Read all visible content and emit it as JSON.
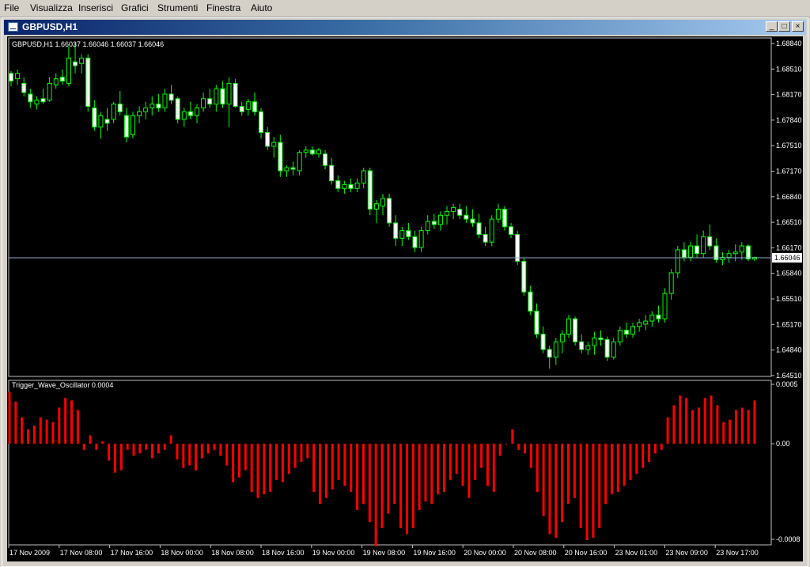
{
  "menu": [
    "File",
    "Visualizza",
    "Inserisci",
    "Grafici",
    "Strumenti",
    "Finestra",
    "Aiuto"
  ],
  "window": {
    "title": "GBPUSD,H1",
    "buttons": {
      "minimize": "_",
      "restore": "□",
      "close": "×"
    }
  },
  "main": {
    "info": "GBPUSD,H1  1.66037 1.66046 1.66037 1.66046",
    "price_labels": [
      "1.68840",
      "1.68510",
      "1.68170",
      "1.67840",
      "1.67510",
      "1.67170",
      "1.66840",
      "1.66510",
      "1.66170",
      "1.65840",
      "1.65510",
      "1.65170",
      "1.64840",
      "1.64510"
    ],
    "current_price": "1.66046"
  },
  "indicator": {
    "label": "Trigger_Wave_Oscillator 0.0004",
    "scale_labels": [
      "0.0005",
      "0.00",
      "-0.0008"
    ]
  },
  "time_labels": [
    "17 Nov 2009",
    "17 Nov 08:00",
    "17 Nov 16:00",
    "18 Nov 00:00",
    "18 Nov 08:00",
    "18 Nov 16:00",
    "19 Nov 00:00",
    "19 Nov 08:00",
    "19 Nov 16:00",
    "20 Nov 00:00",
    "20 Nov 08:00",
    "20 Nov 16:00",
    "23 Nov 01:00",
    "23 Nov 09:00",
    "23 Nov 17:00"
  ],
  "colors": {
    "candle": "#00ff00",
    "bull_body": "#000000",
    "bear_body": "#ffffff",
    "osc_bar": "#ff0000",
    "price_line": "#8fa8c8"
  },
  "chart_data": [
    {
      "type": "candlestick",
      "title": "GBPUSD,H1",
      "ylim": [
        1.645,
        1.69
      ],
      "ohlc": [
        [
          1.6845,
          1.6848,
          1.6828,
          1.6835
        ],
        [
          1.6838,
          1.685,
          1.683,
          1.6845
        ],
        [
          1.6832,
          1.684,
          1.6815,
          1.682
        ],
        [
          1.6818,
          1.6825,
          1.68,
          1.6808
        ],
        [
          1.6805,
          1.6815,
          1.6798,
          1.681
        ],
        [
          1.6812,
          1.6825,
          1.6805,
          1.6808
        ],
        [
          1.681,
          1.684,
          1.6808,
          1.6832
        ],
        [
          1.683,
          1.6845,
          1.6825,
          1.6838
        ],
        [
          1.684,
          1.685,
          1.683,
          1.6835
        ],
        [
          1.6832,
          1.688,
          1.6828,
          1.6865
        ],
        [
          1.686,
          1.6885,
          1.6845,
          1.6855
        ],
        [
          1.6858,
          1.687,
          1.6845,
          1.6865
        ],
        [
          1.6865,
          1.687,
          1.6795,
          1.6802
        ],
        [
          1.68,
          1.681,
          1.677,
          1.6775
        ],
        [
          1.6775,
          1.6795,
          1.676,
          1.679
        ],
        [
          1.6785,
          1.68,
          1.677,
          1.678
        ],
        [
          1.6785,
          1.6808,
          1.678,
          1.6805
        ],
        [
          1.6805,
          1.6822,
          1.679,
          1.6795
        ],
        [
          1.679,
          1.68,
          1.6755,
          1.6762
        ],
        [
          1.6765,
          1.6795,
          1.676,
          1.679
        ],
        [
          1.679,
          1.6802,
          1.678,
          1.6795
        ],
        [
          1.6795,
          1.6808,
          1.6785,
          1.68
        ],
        [
          1.68,
          1.6815,
          1.679,
          1.6805
        ],
        [
          1.6805,
          1.6818,
          1.6795,
          1.68
        ],
        [
          1.68,
          1.6825,
          1.6795,
          1.6818
        ],
        [
          1.6818,
          1.683,
          1.6805,
          1.681
        ],
        [
          1.6812,
          1.6815,
          1.678,
          1.6785
        ],
        [
          1.6785,
          1.68,
          1.6775,
          1.6795
        ],
        [
          1.6795,
          1.6808,
          1.6785,
          1.679
        ],
        [
          1.679,
          1.6805,
          1.678,
          1.68
        ],
        [
          1.68,
          1.682,
          1.6795,
          1.6812
        ],
        [
          1.6812,
          1.6825,
          1.68,
          1.6805
        ],
        [
          1.6805,
          1.683,
          1.6795,
          1.6825
        ],
        [
          1.6825,
          1.6835,
          1.68,
          1.6805
        ],
        [
          1.6805,
          1.684,
          1.6775,
          1.6832
        ],
        [
          1.6832,
          1.6838,
          1.68,
          1.6802
        ],
        [
          1.6802,
          1.6808,
          1.679,
          1.6795
        ],
        [
          1.6798,
          1.6812,
          1.679,
          1.6808
        ],
        [
          1.6808,
          1.682,
          1.679,
          1.6795
        ],
        [
          1.6795,
          1.68,
          1.676,
          1.6768
        ],
        [
          1.6768,
          1.6775,
          1.6745,
          1.675
        ],
        [
          1.675,
          1.6762,
          1.6735,
          1.6755
        ],
        [
          1.6755,
          1.6765,
          1.671,
          1.6718
        ],
        [
          1.6718,
          1.6725,
          1.671,
          1.6722
        ],
        [
          1.6722,
          1.673,
          1.6712,
          1.672
        ],
        [
          1.6718,
          1.6745,
          1.6712,
          1.6742
        ],
        [
          1.6742,
          1.675,
          1.6735,
          1.6745
        ],
        [
          1.6745,
          1.675,
          1.6738,
          1.674
        ],
        [
          1.674,
          1.6748,
          1.6735,
          1.6745
        ],
        [
          1.674,
          1.6745,
          1.672,
          1.6725
        ],
        [
          1.6725,
          1.6735,
          1.67,
          1.6705
        ],
        [
          1.6705,
          1.6712,
          1.669,
          1.6695
        ],
        [
          1.6695,
          1.6705,
          1.6688,
          1.67
        ],
        [
          1.67,
          1.6708,
          1.669,
          1.6695
        ],
        [
          1.6695,
          1.6708,
          1.669,
          1.6702
        ],
        [
          1.6702,
          1.6722,
          1.6695,
          1.6718
        ],
        [
          1.6718,
          1.6722,
          1.666,
          1.6668
        ],
        [
          1.6668,
          1.668,
          1.665,
          1.6675
        ],
        [
          1.6672,
          1.6688,
          1.666,
          1.6682
        ],
        [
          1.6682,
          1.6688,
          1.6645,
          1.665
        ],
        [
          1.665,
          1.666,
          1.662,
          1.663
        ],
        [
          1.663,
          1.6645,
          1.662,
          1.664
        ],
        [
          1.664,
          1.665,
          1.6628,
          1.6632
        ],
        [
          1.6632,
          1.664,
          1.6612,
          1.6618
        ],
        [
          1.6618,
          1.6645,
          1.6612,
          1.664
        ],
        [
          1.664,
          1.666,
          1.6635,
          1.6652
        ],
        [
          1.6652,
          1.6662,
          1.6642,
          1.6648
        ],
        [
          1.6648,
          1.6665,
          1.664,
          1.666
        ],
        [
          1.666,
          1.6672,
          1.6648,
          1.6665
        ],
        [
          1.6665,
          1.6675,
          1.6655,
          1.667
        ],
        [
          1.6668,
          1.6675,
          1.6655,
          1.666
        ],
        [
          1.666,
          1.6672,
          1.665,
          1.6655
        ],
        [
          1.6655,
          1.6668,
          1.6645,
          1.665
        ],
        [
          1.665,
          1.6662,
          1.663,
          1.6635
        ],
        [
          1.6635,
          1.6645,
          1.662,
          1.6625
        ],
        [
          1.6625,
          1.666,
          1.662,
          1.6655
        ],
        [
          1.6655,
          1.6675,
          1.665,
          1.6668
        ],
        [
          1.6668,
          1.6672,
          1.664,
          1.6645
        ],
        [
          1.6645,
          1.665,
          1.663,
          1.6635
        ],
        [
          1.6635,
          1.664,
          1.6595,
          1.66
        ],
        [
          1.66,
          1.6605,
          1.6555,
          1.656
        ],
        [
          1.656,
          1.6568,
          1.653,
          1.6535
        ],
        [
          1.6535,
          1.6545,
          1.65,
          1.6505
        ],
        [
          1.6505,
          1.6515,
          1.648,
          1.6485
        ],
        [
          1.6485,
          1.649,
          1.646,
          1.6475
        ],
        [
          1.6475,
          1.65,
          1.6465,
          1.6495
        ],
        [
          1.6495,
          1.651,
          1.648,
          1.6505
        ],
        [
          1.6505,
          1.653,
          1.65,
          1.6525
        ],
        [
          1.6525,
          1.6528,
          1.649,
          1.6495
        ],
        [
          1.6495,
          1.6505,
          1.648,
          1.6485
        ],
        [
          1.6485,
          1.6495,
          1.6478,
          1.649
        ],
        [
          1.649,
          1.6508,
          1.6478,
          1.65
        ],
        [
          1.65,
          1.651,
          1.649,
          1.6498
        ],
        [
          1.6498,
          1.6502,
          1.647,
          1.6475
        ],
        [
          1.6475,
          1.65,
          1.6472,
          1.6495
        ],
        [
          1.6495,
          1.6515,
          1.649,
          1.651
        ],
        [
          1.651,
          1.652,
          1.65,
          1.6505
        ],
        [
          1.6505,
          1.652,
          1.65,
          1.6515
        ],
        [
          1.6515,
          1.6525,
          1.6508,
          1.652
        ],
        [
          1.6518,
          1.653,
          1.651,
          1.6522
        ],
        [
          1.6522,
          1.6535,
          1.6515,
          1.653
        ],
        [
          1.653,
          1.6542,
          1.652,
          1.6525
        ],
        [
          1.6525,
          1.6565,
          1.652,
          1.6558
        ],
        [
          1.6558,
          1.659,
          1.655,
          1.6585
        ],
        [
          1.6585,
          1.662,
          1.6578,
          1.6615
        ],
        [
          1.6615,
          1.6625,
          1.66,
          1.6605
        ],
        [
          1.6605,
          1.6625,
          1.66,
          1.662
        ],
        [
          1.662,
          1.6635,
          1.6605,
          1.661
        ],
        [
          1.661,
          1.664,
          1.6605,
          1.6632
        ],
        [
          1.6632,
          1.6648,
          1.6615,
          1.662
        ],
        [
          1.662,
          1.663,
          1.6598,
          1.6602
        ],
        [
          1.6602,
          1.6612,
          1.6595,
          1.6605
        ],
        [
          1.6605,
          1.6615,
          1.6598,
          1.661
        ],
        [
          1.661,
          1.6622,
          1.66,
          1.6612
        ],
        [
          1.6612,
          1.6625,
          1.6602,
          1.662
        ],
        [
          1.662,
          1.6622,
          1.66,
          1.6603
        ],
        [
          1.6603,
          1.6606,
          1.66,
          1.6605
        ]
      ]
    },
    {
      "type": "bar",
      "title": "Trigger_Wave_Oscillator 0.0004",
      "ylim": [
        -0.0008,
        0.0005
      ],
      "values": [
        0.00043,
        0.00035,
        0.00022,
        0.00012,
        0.00015,
        0.00022,
        0.0002,
        0.00018,
        0.0003,
        0.00038,
        0.00036,
        0.00028,
        -5e-05,
        7e-05,
        -5e-05,
        2e-05,
        -0.00014,
        -0.00024,
        -0.00022,
        -5e-05,
        -0.0001,
        -8e-05,
        -5e-05,
        -0.00012,
        -8e-05,
        -5e-05,
        7e-05,
        -0.00013,
        -0.0002,
        -0.00018,
        -0.00022,
        -0.00012,
        -8e-05,
        -5e-05,
        -0.0001,
        -0.00018,
        -0.00032,
        -0.00028,
        -0.00022,
        -0.0004,
        -0.00045,
        -0.00042,
        -0.0004,
        -0.0003,
        -0.00032,
        -0.00025,
        -0.0002,
        -0.00015,
        -0.00012,
        -0.0004,
        -0.0005,
        -0.00045,
        -0.00038,
        -0.0003,
        -0.00035,
        -0.0004,
        -0.00055,
        -0.0005,
        -0.00065,
        -0.00085,
        -0.0007,
        -0.00058,
        -0.0005,
        -0.0007,
        -0.00075,
        -0.0007,
        -0.00055,
        -0.00048,
        -0.0005,
        -0.00042,
        -0.0004,
        -0.0003,
        -0.00025,
        -0.00035,
        -0.00045,
        -0.0003,
        -0.0002,
        -0.00035,
        -0.0004,
        -0.0001,
        0.0,
        0.00012,
        -5e-05,
        -8e-05,
        -0.0002,
        -0.0004,
        -0.0006,
        -0.00075,
        -0.00078,
        -0.00065,
        -0.0005,
        -0.00045,
        -0.0007,
        -0.0008,
        -0.00078,
        -0.0007,
        -0.0005,
        -0.00042,
        -0.0004,
        -0.00035,
        -0.0003,
        -0.00025,
        -0.0002,
        -0.00015,
        -8e-05,
        -5e-05,
        0.00022,
        0.00032,
        0.0004,
        0.00038,
        0.00028,
        0.0003,
        0.00038,
        0.0004,
        0.00032,
        0.00018,
        0.0002,
        0.00028,
        0.0003,
        0.00028,
        0.00036
      ]
    }
  ]
}
